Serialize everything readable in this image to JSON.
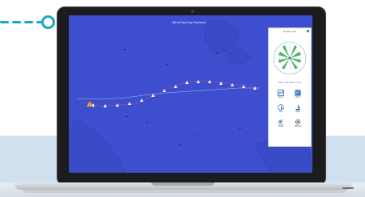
{
  "app": {
    "map_title": "Wind Routing Trackout"
  },
  "panel": {
    "header": "N  Wind  Sail",
    "polar_caption": "Wind  Sail Polar Curve",
    "buttons": [
      {
        "label": "Route",
        "icon": "map-route-icon"
      },
      {
        "label": "Wind",
        "icon": "wind-icon"
      },
      {
        "label": "Sail",
        "icon": "sail-icon"
      },
      {
        "label": "Boat",
        "icon": "boat-icon"
      },
      {
        "label": "Route",
        "icon": "route-arrows-icon"
      },
      {
        "label": "Settings",
        "icon": "gear-icon"
      }
    ]
  },
  "colors": {
    "screen": "#3d4fcf",
    "accent": "#17a9c4",
    "track": "#e05a5a",
    "marker": "#ffffff",
    "polar_green": "#2ba84a"
  }
}
